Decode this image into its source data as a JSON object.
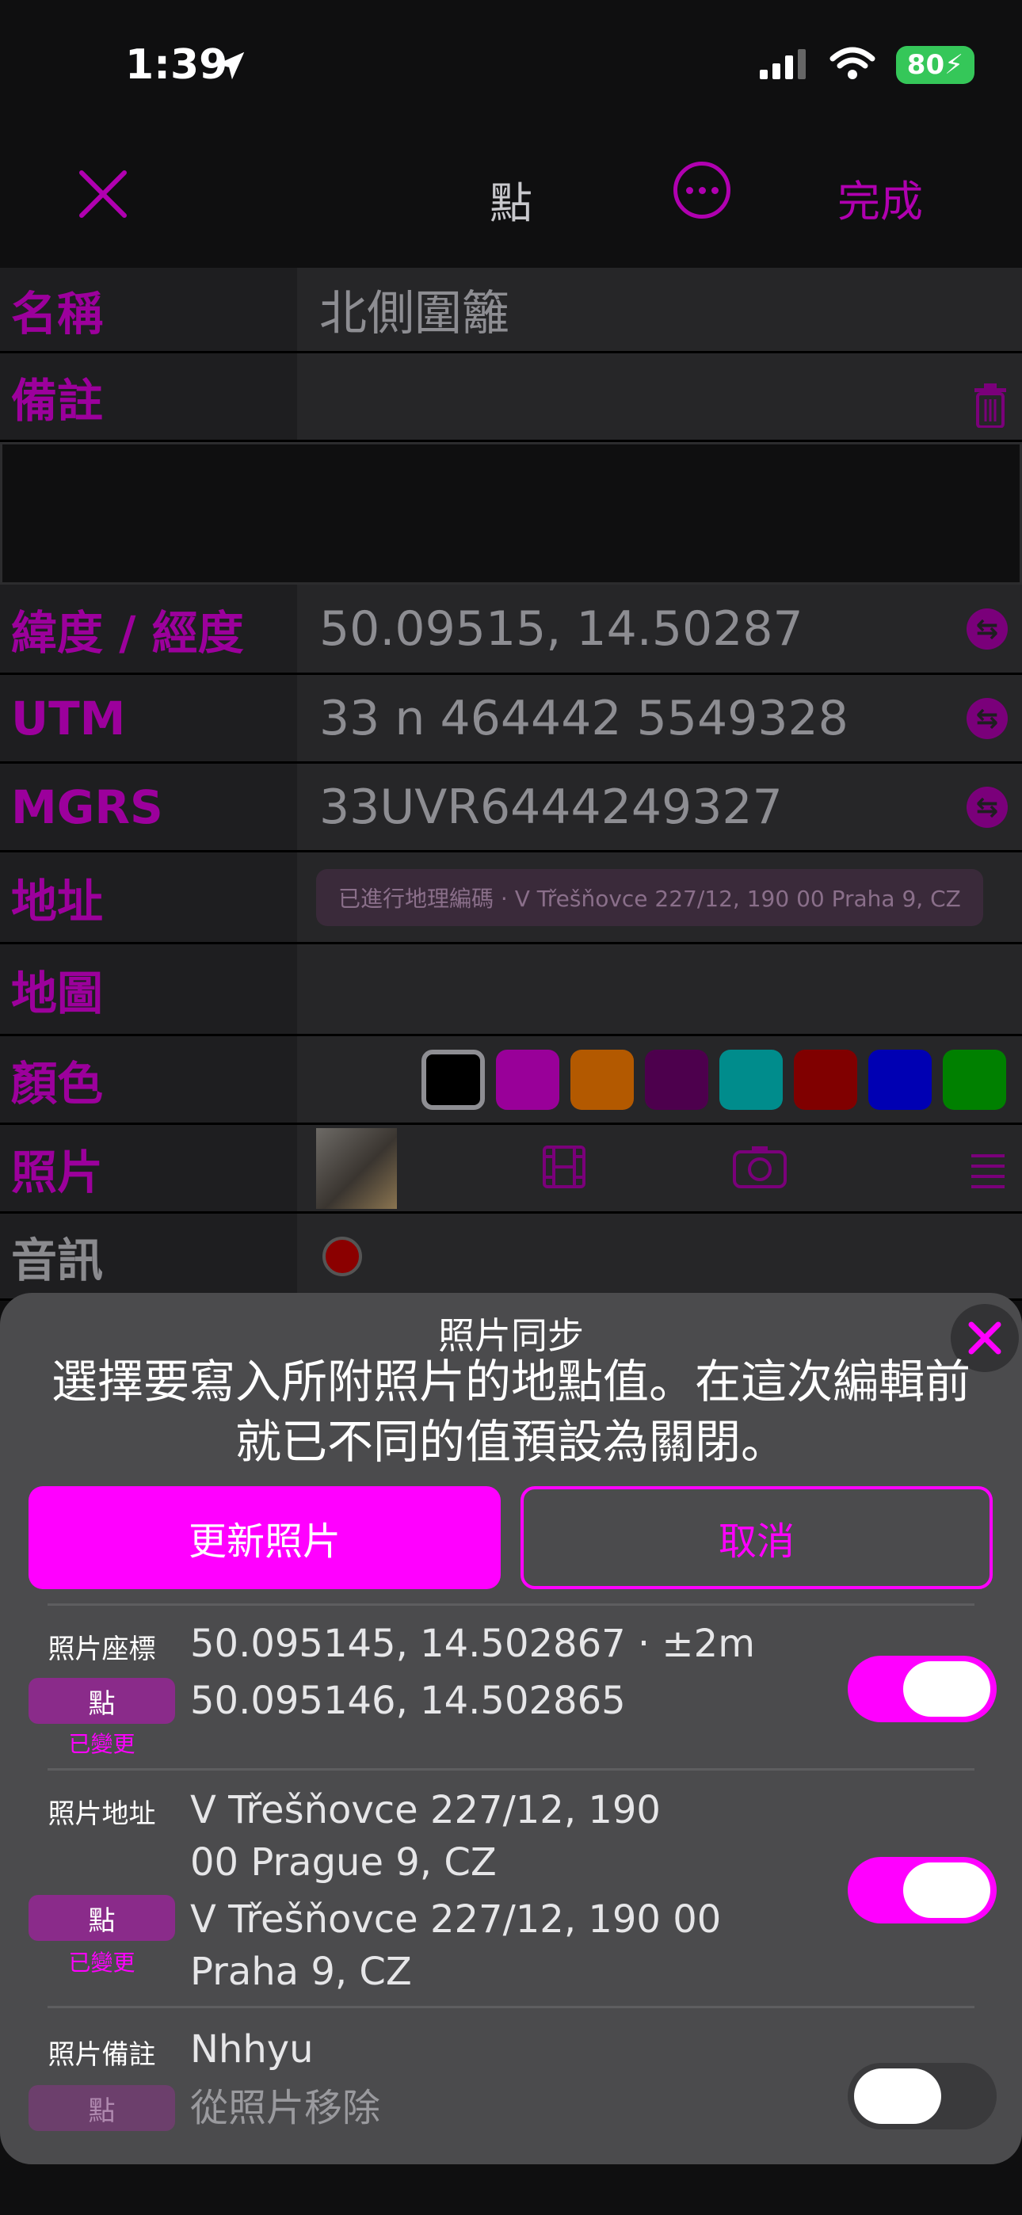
{
  "status": {
    "time": "1:39",
    "battery": "80"
  },
  "nav": {
    "title": "點",
    "done": "完成"
  },
  "form": {
    "name": {
      "label": "名稱",
      "value": "北側圍籬"
    },
    "notes": {
      "label": "備註"
    },
    "latlon": {
      "label": "緯度 / 經度",
      "value": "50.09515, 14.50287"
    },
    "utm": {
      "label": "UTM",
      "value": "33 n 464442 5549328"
    },
    "mgrs": {
      "label": "MGRS",
      "value": "33UVR6444249327"
    },
    "address": {
      "label": "地址",
      "value": "已進行地理編碼 · V Třešňovce 227/12, 190 00 Praha 9, CZ"
    },
    "map": {
      "label": "地圖"
    },
    "color": {
      "label": "顏色",
      "swatches": [
        "#000000",
        "#990099",
        "#b35900",
        "#4d004d",
        "#008c8c",
        "#800000",
        "#0000b3",
        "#008000"
      ]
    },
    "photo": {
      "label": "照片"
    },
    "audio": {
      "label": "音訊"
    }
  },
  "sheet": {
    "title": "照片同步",
    "message": "選擇要寫入所附照片的地點值。在這次編輯前就已不同的值預設為關閉。",
    "update_button": "更新照片",
    "cancel_button": "取消",
    "items": [
      {
        "label": "照片座標",
        "photo_value": "50.095145, 14.502867 · ±2m",
        "point_label": "點",
        "point_value": "50.095146, 14.502865",
        "changed": "已變更",
        "enabled": true
      },
      {
        "label": "照片地址",
        "photo_value": "V Třešňovce 227/12, 190 00 Prague 9, CZ",
        "point_label": "點",
        "point_value": "V Třešňovce 227/12, 190 00 Praha 9, CZ",
        "changed": "已變更",
        "enabled": true
      },
      {
        "label": "照片備註",
        "photo_value": "Nhhyu",
        "point_label": "點",
        "point_value": "從照片移除",
        "enabled": false
      }
    ]
  }
}
